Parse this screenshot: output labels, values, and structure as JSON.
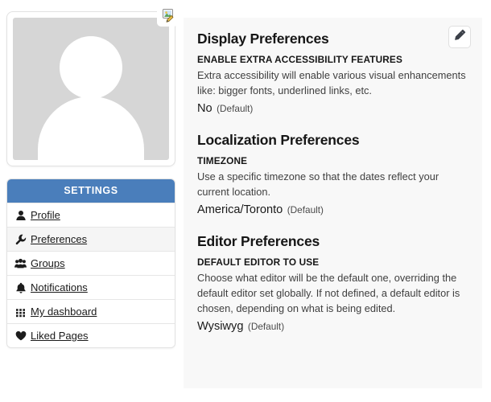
{
  "profile_card": {
    "avatar_alt": "default user avatar placeholder",
    "edit_icon": "image-edit-icon"
  },
  "sidebar": {
    "header": "SETTINGS",
    "items": [
      {
        "label": "Profile",
        "icon": "user-icon",
        "active": false
      },
      {
        "label": "Preferences",
        "icon": "wrench-icon",
        "active": true
      },
      {
        "label": "Groups",
        "icon": "users-group-icon",
        "active": false
      },
      {
        "label": "Notifications",
        "icon": "bell-icon",
        "active": false
      },
      {
        "label": "My dashboard",
        "icon": "grid-icon",
        "active": false
      },
      {
        "label": "Liked Pages",
        "icon": "heart-icon",
        "active": false
      }
    ]
  },
  "panel": {
    "edit_icon": "pencil-icon",
    "sections": [
      {
        "title": "Display Preferences",
        "field_label": "ENABLE EXTRA ACCESSIBILITY FEATURES",
        "description": "Extra accessibility will enable various visual enhancements like: bigger fonts, underlined links, etc.",
        "value": "No",
        "value_note": "(Default)"
      },
      {
        "title": "Localization Preferences",
        "field_label": "TIMEZONE",
        "description": "Use a specific timezone so that the dates reflect your current location.",
        "value": "America/Toronto",
        "value_note": "(Default)"
      },
      {
        "title": "Editor Preferences",
        "field_label": "DEFAULT EDITOR TO USE",
        "description": "Choose what editor will be the default one, overriding the default editor set globally. If not defined, a default editor is chosen, depending on what is being edited.",
        "value": "Wysiwyg",
        "value_note": "(Default)"
      }
    ]
  },
  "colors": {
    "sidebar_header_bg": "#4a7ebb",
    "panel_bg": "#f8f8f8",
    "avatar_placeholder": "#d6d6d6",
    "active_row_bg": "#f5f5f5"
  }
}
